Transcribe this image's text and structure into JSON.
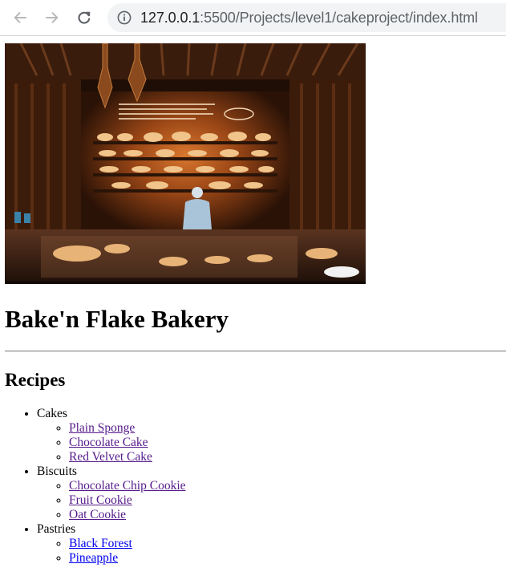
{
  "browser": {
    "url_host": "127.0.0.1",
    "url_rest": ":5500/Projects/level1/cakeproject/index.html",
    "icons": [
      "back-arrow-icon",
      "forward-arrow-icon",
      "reload-icon",
      "info-icon"
    ]
  },
  "page": {
    "hero_image": "bakery display counter with shelves of bread and a baker",
    "title": "Bake'n Flake Bakery",
    "section_title": "Recipes",
    "categories": [
      {
        "label": "Cakes",
        "items": [
          {
            "label": "Plain Sponge",
            "visited": true
          },
          {
            "label": "Chocolate Cake",
            "visited": true
          },
          {
            "label": "Red Velvet Cake",
            "visited": true
          }
        ]
      },
      {
        "label": "Biscuits",
        "items": [
          {
            "label": "Chocolate Chip Cookie",
            "visited": true
          },
          {
            "label": "Fruit Cookie",
            "visited": true
          },
          {
            "label": "Oat Cookie",
            "visited": true
          }
        ]
      },
      {
        "label": "Pastries",
        "items": [
          {
            "label": "Black Forest",
            "visited": false
          },
          {
            "label": "Pineapple",
            "visited": false
          }
        ]
      }
    ]
  },
  "colors": {
    "link": "#0000ee",
    "visited_link": "#551a8b",
    "address_bar_bg": "#f1f3f4"
  }
}
